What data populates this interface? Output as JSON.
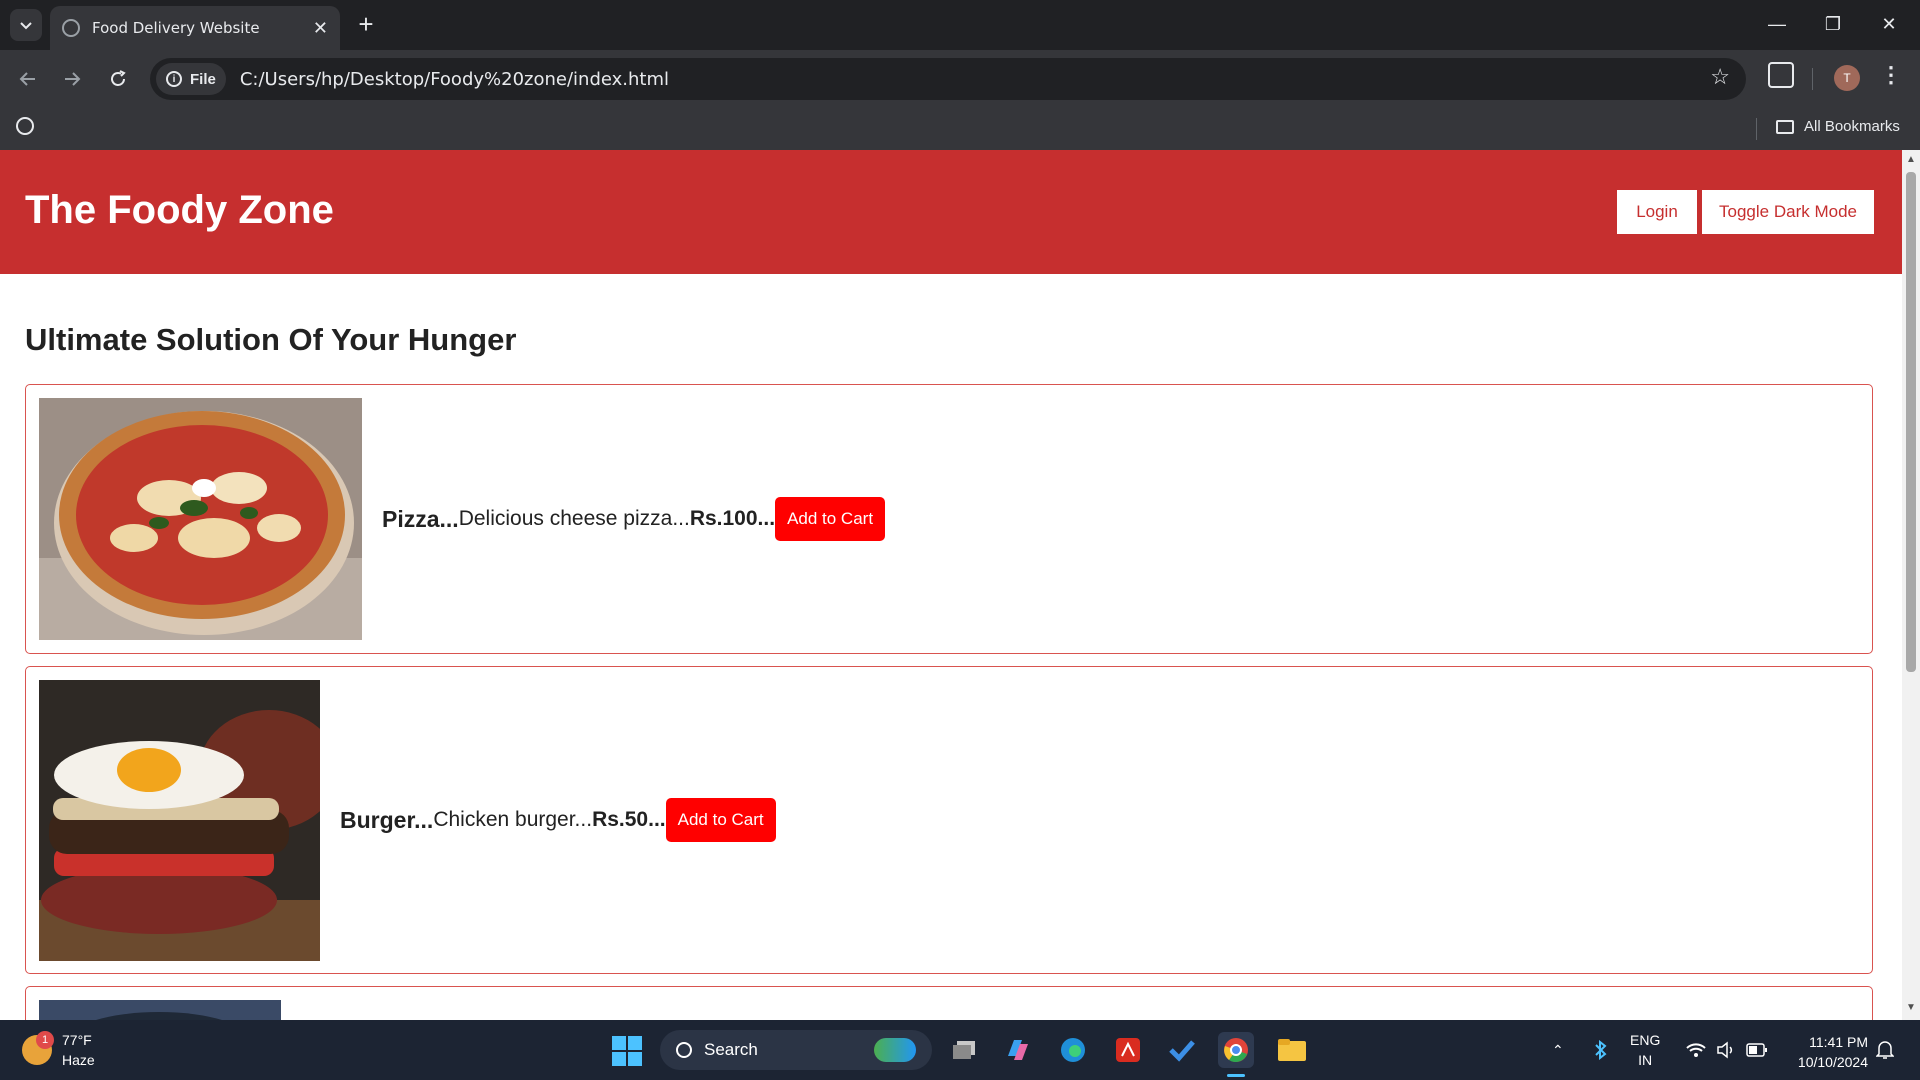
{
  "browser": {
    "tab_title": "Food Delivery Website",
    "url_chip": "File",
    "url": "C:/Users/hp/Desktop/Foody%20zone/index.html",
    "profile_initial": "T",
    "all_bookmarks": "All Bookmarks"
  },
  "site": {
    "title": "The Foody Zone",
    "login_label": "Login",
    "dark_mode_label": "Toggle Dark Mode",
    "heading": "Ultimate Solution Of Your Hunger",
    "items": [
      {
        "name": "Pizza...",
        "description": "Delicious cheese pizza...",
        "price": "Rs.100...",
        "button": "Add to Cart"
      },
      {
        "name": "Burger...",
        "description": "Chicken burger...",
        "price": "Rs.50...",
        "button": "Add to Cart"
      }
    ]
  },
  "taskbar": {
    "weather_temp": "77°F",
    "weather_desc": "Haze",
    "weather_badge": "1",
    "search_label": "Search",
    "lang_top": "ENG",
    "lang_bottom": "IN",
    "time": "11:41 PM",
    "date": "10/10/2024"
  },
  "colors": {
    "brand_red": "#c62f2f",
    "cart_button": "#ff0000",
    "card_border": "#d9534f"
  }
}
